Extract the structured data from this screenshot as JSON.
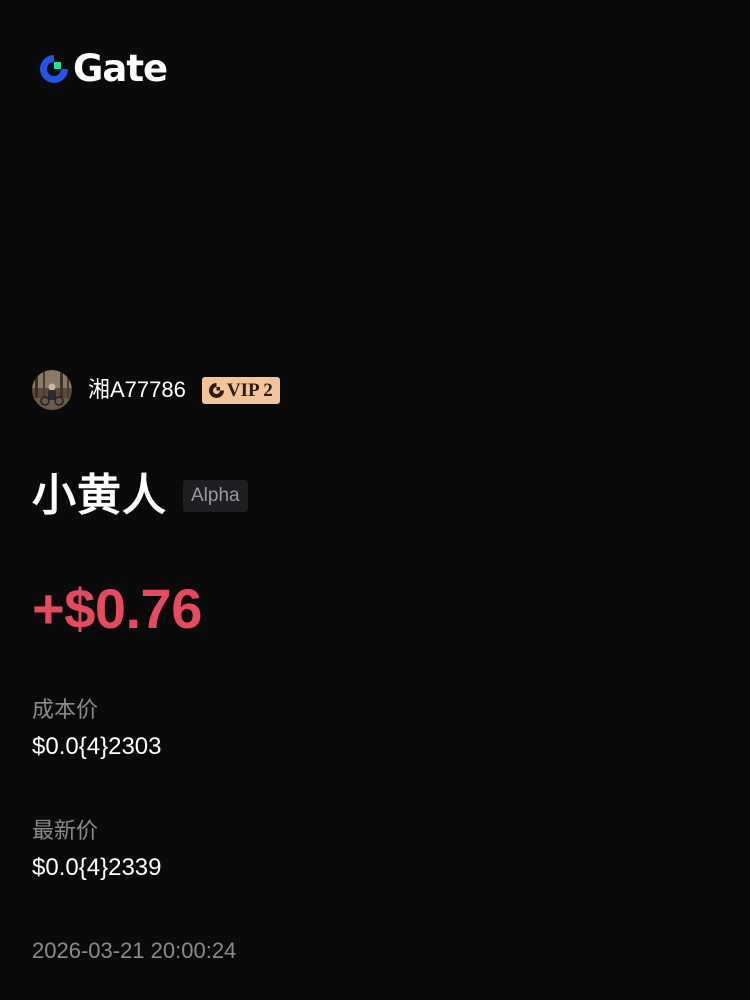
{
  "brand": {
    "logo_text": "Gate",
    "icon": "gate-logo-icon",
    "colors": {
      "blue": "#2354e6",
      "green": "#17e6a1"
    }
  },
  "user": {
    "avatar_icon": "avatar-image",
    "name": "湘A77786",
    "vip_label": "VIP 2",
    "vip_badge_color": "#f3c39c"
  },
  "token": {
    "name": "小黄人",
    "tag": "Alpha"
  },
  "pnl": {
    "value": "+$0.76",
    "color": "#e54b5f"
  },
  "cost_price": {
    "label": "成本价",
    "value": "$0.0{4}2303"
  },
  "last_price": {
    "label": "最新价",
    "value": "$0.0{4}2339"
  },
  "timestamp": "2026-03-21 20:00:24"
}
